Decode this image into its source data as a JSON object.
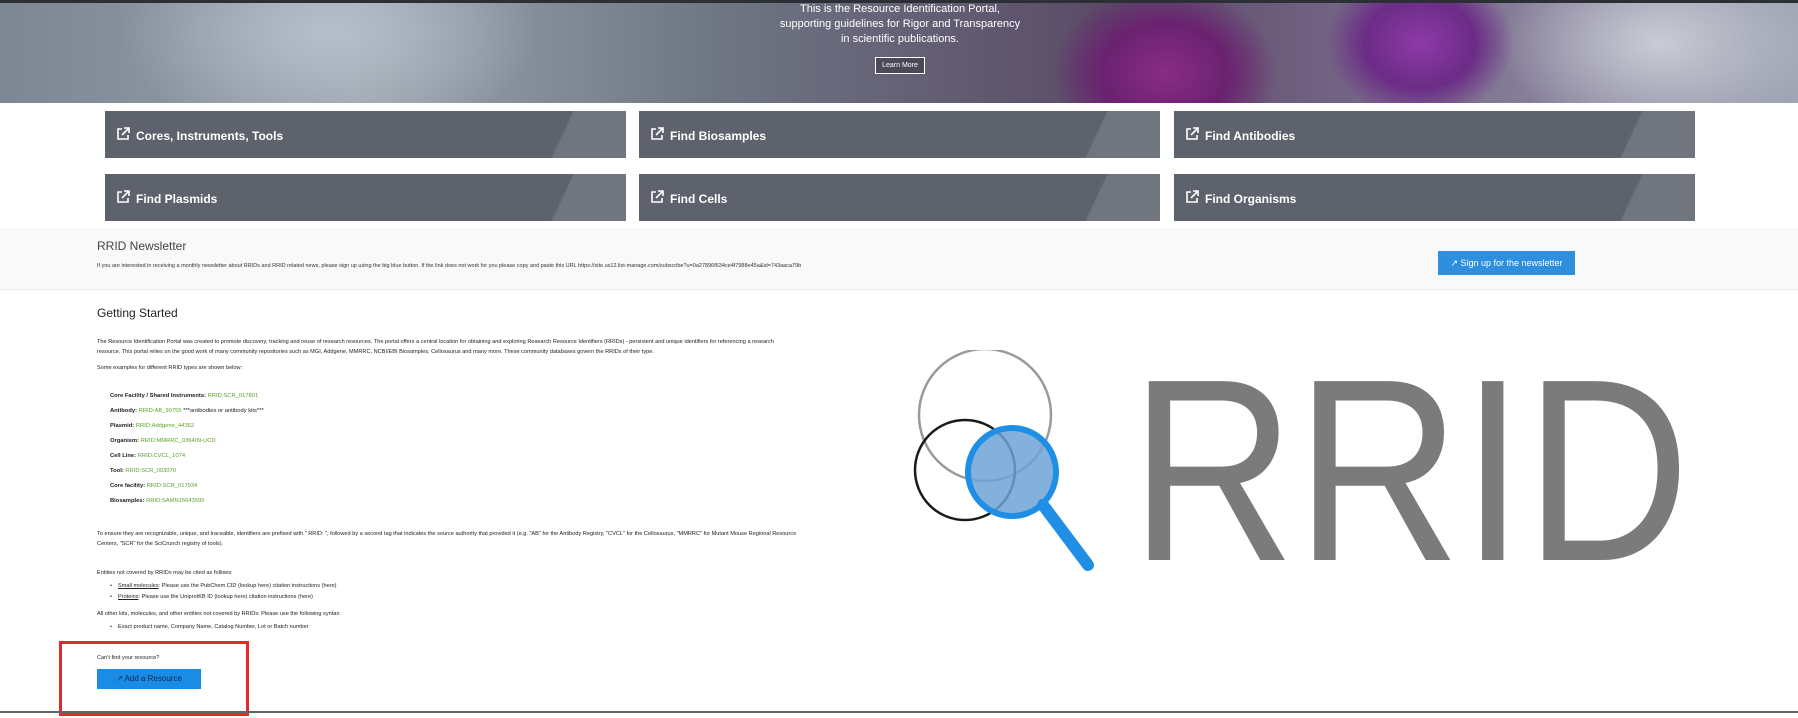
{
  "hero": {
    "line1": "This is the Resource Identification Portal,",
    "line2": "supporting guidelines for Rigor and Transparency",
    "line3": "in scientific publications.",
    "learn_more": "Learn More"
  },
  "tiles": [
    {
      "label": "Cores, Instruments, Tools"
    },
    {
      "label": "Find Biosamples"
    },
    {
      "label": "Find Antibodies"
    },
    {
      "label": "Find Plasmids"
    },
    {
      "label": "Find Cells"
    },
    {
      "label": "Find Organisms"
    }
  ],
  "newsletter": {
    "title": "RRID Newsletter",
    "desc": "If you are interested in receiving a monthly newsletter about RRIDs and RRID related news, please sign up using the big blue button. If the link does not work for you please copy and paste this URL https://site.us12.list-manage.com/subscribe?u=0a27896f634ce4f7988e45a&id=743aaca79b",
    "button": "Sign up for the newsletter"
  },
  "getting_started": {
    "title": "Getting Started",
    "p1a": "The Resource Identification Portal was created to promote discovery, tracking and reuse of research resources. The portal offers a central location for obtaining and exploring Research Resource Identifiers (RRIDs) - persistent and unique identifiers for referencing a research",
    "p1b": "resource. This portal relies on the good work of many community repositories such as MGI, Addgene, MMRRC, NCBI/EBI Biosamples, Cellosaurus and many more. These community databases govern the RRIDs of their type.",
    "p2": "Some examples for different RRID types are shown below:",
    "examples": [
      {
        "label": "Core Facility / Shared Instruments:",
        "value": "RRID:SCR_017801",
        "extra": ""
      },
      {
        "label": "Antibody:",
        "value": "RRID:AB_90755",
        "extra": " ***antibodies or antibody kits***"
      },
      {
        "label": "Plasmid:",
        "value": "RRID:Addgene_44362",
        "extra": ""
      },
      {
        "label": "Organism:",
        "value": "RRID:MMRRC_036409-UCD",
        "extra": ""
      },
      {
        "label": "Cell Line:",
        "value": "RRID:CVCL_1074",
        "extra": ""
      },
      {
        "label": "Tool:",
        "value": "RRID:SCR_003070",
        "extra": ""
      },
      {
        "label": "Core facility:",
        "value": "RRID:SCR_017934",
        "extra": ""
      },
      {
        "label": "Biosamples:",
        "value": "RRID:SAMN15643595",
        "extra": ""
      }
    ],
    "p3a": "To ensure they are recognizable, unique, and traceable, identifiers are prefixed with \" RRID: \", followed by a second tag that indicates the source authority that provided it (e.g. \"AB\" for the Antibody Registry, \"CVCL\" for the Cellosaurus, \"MMRRC\" for Mutant Mouse Regional Resource",
    "p3b": "Centers, \"SCR\" for the SciCrunch registry of tools).",
    "p4": "Entities not covered by RRIDs may be cited as follows:",
    "bullet1_link": "Small molecules",
    "bullet1_rest": ": Please use the PubChem CID (lookup here) citation instructions (here)",
    "bullet2_link": "Proteins",
    "bullet2_rest": ": Please use the UniprotKB ID (lookup here) citation instructions (here)",
    "p5": "All other kits, molecules, and other entities not covered by RRIDs: Please use the following syntax:",
    "bullet3": "Exact product name, Company Name, Catalog Number, Lot or Batch number",
    "cant_find": "Can't find your resource?",
    "add_button": "Add a Resource"
  },
  "logo": {
    "text": "RRID"
  },
  "colors": {
    "tile": "#5d626c",
    "link_green": "#5ba02a",
    "button_blue": "#2d8fdd",
    "highlight_red": "#e32a2a"
  }
}
